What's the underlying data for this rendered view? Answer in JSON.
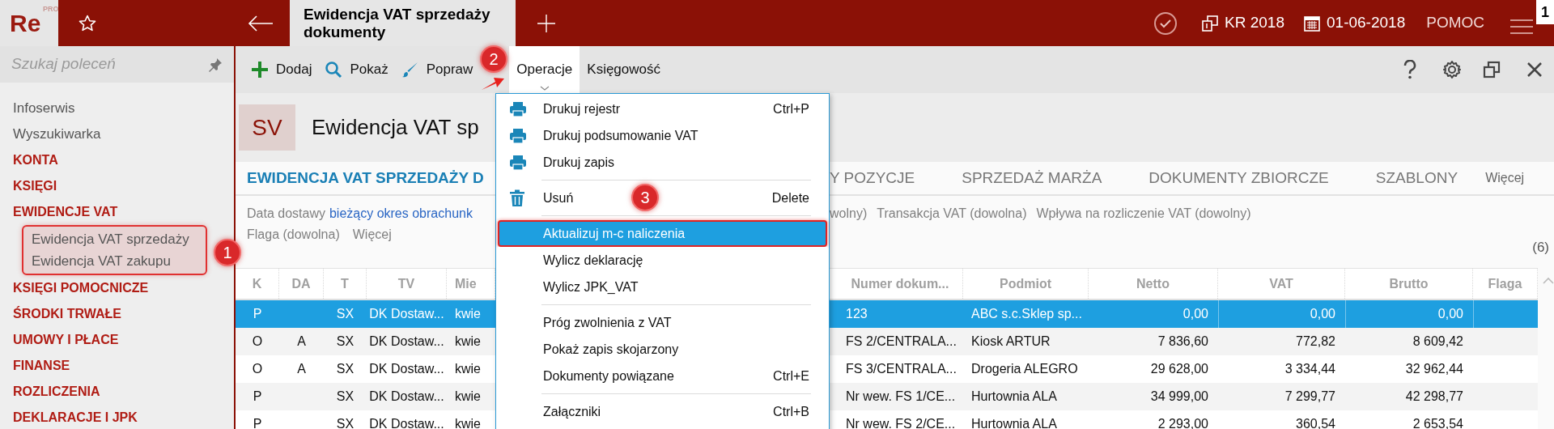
{
  "app": {
    "logo": "Re",
    "logo_badge": "PRO",
    "window_number": "1"
  },
  "top_bar": {
    "tab_title": "Ewidencja VAT sprzedaży dokumenty",
    "company": "KR 2018",
    "date": "01-06-2018",
    "help": "POMOC"
  },
  "sidebar": {
    "search_placeholder": "Szukaj poleceń",
    "items": [
      {
        "label": "Infoserwis",
        "kind": "link"
      },
      {
        "label": "Wyszukiwarka",
        "kind": "link"
      },
      {
        "label": "KONTA",
        "kind": "section"
      },
      {
        "label": "KSIĘGI",
        "kind": "section"
      },
      {
        "label": "EWIDENCJE VAT",
        "kind": "section",
        "children": [
          {
            "label": "Ewidencja VAT sprzedaży",
            "kind": "link"
          },
          {
            "label": "Ewidencja VAT zakupu",
            "kind": "link"
          }
        ]
      },
      {
        "label": "KSIĘGI POMOCNICZE",
        "kind": "section"
      },
      {
        "label": "ŚRODKI TRWAŁE",
        "kind": "section"
      },
      {
        "label": "UMOWY I PŁACE",
        "kind": "section"
      },
      {
        "label": "FINANSE",
        "kind": "section"
      },
      {
        "label": "ROZLICZENIA",
        "kind": "section"
      },
      {
        "label": "DEKLARACJE I JPK",
        "kind": "section"
      }
    ]
  },
  "toolbar": {
    "buttons": [
      {
        "label": "Dodaj",
        "kind": "action"
      },
      {
        "label": "Pokaż",
        "kind": "action"
      },
      {
        "label": "Popraw",
        "kind": "action"
      },
      {
        "label": "Operacje",
        "kind": "menu",
        "open": true
      },
      {
        "label": "Księgowość",
        "kind": "menu",
        "open": false
      }
    ]
  },
  "view": {
    "badge": "SV",
    "title": "Ewidencja VAT sp",
    "tabs": [
      {
        "label": "EWIDENCJA VAT SPRZEDAŻY D",
        "selected": true
      },
      {
        "label": "Y POZYCJE",
        "selected": false
      },
      {
        "label": "SPRZEDAŻ MARŻA",
        "selected": false
      },
      {
        "label": "DOKUMENTY ZBIORCZE",
        "selected": false
      },
      {
        "label": "SZABLONY",
        "selected": false
      }
    ],
    "tabs_more": "Więcej",
    "filters": [
      {
        "label": "Data dostawy",
        "value": "bieżący okres obrachunk"
      },
      {
        "label": "wolny)"
      },
      {
        "label": "Transakcja VAT (dowolna)"
      },
      {
        "label": "Wpływa na rozliczenie VAT (dowolny)"
      }
    ],
    "filters_line2": [
      "Flaga (dowolna)"
    ],
    "filters_more": "Więcej",
    "count": "(6)"
  },
  "table": {
    "columns": [
      "K",
      "DA",
      "T",
      "TV",
      "Mie",
      "Numer dokum...",
      "Podmiot",
      "Netto",
      "VAT",
      "Brutto",
      "Flaga"
    ],
    "rows": [
      {
        "cells": [
          "P",
          "",
          "SX",
          "DK Dostaw...",
          "kwie",
          "123",
          "ABC s.c.Sklep sp...",
          "0,00",
          "0,00",
          "0,00"
        ],
        "selected": true
      },
      {
        "cells": [
          "O",
          "A",
          "SX",
          "DK Dostaw...",
          "kwie",
          "FS 2/CENTRALA...",
          "Kiosk ARTUR",
          "7 836,60",
          "772,82",
          "8 609,42"
        ],
        "selected": false
      },
      {
        "cells": [
          "O",
          "A",
          "SX",
          "DK Dostaw...",
          "kwie",
          "FS 3/CENTRALA...",
          "Drogeria ALEGRO",
          "29 628,00",
          "3 334,44",
          "32 962,44"
        ],
        "selected": false
      },
      {
        "cells": [
          "P",
          "",
          "SX",
          "DK Dostaw...",
          "kwie",
          "Nr wew. FS 1/CE...",
          "Hurtownia ALA",
          "34 999,00",
          "7 299,77",
          "42 298,77"
        ],
        "selected": false
      },
      {
        "cells": [
          "P",
          "",
          "SX",
          "DK Dostaw...",
          "kwie",
          "Nr wew. FS 2/CE...",
          "Hurtownia ALA",
          "2 293,00",
          "360,54",
          "2 653,54"
        ],
        "selected": false
      }
    ]
  },
  "menu": {
    "groups": [
      [
        {
          "label": "Drukuj rejestr",
          "shortcut": "Ctrl+P",
          "selected": false
        },
        {
          "label": "Drukuj podsumowanie VAT",
          "selected": false
        },
        {
          "label": "Drukuj zapis",
          "selected": false
        }
      ],
      [
        {
          "label": "Usuń",
          "shortcut": "Delete",
          "selected": false
        }
      ],
      [
        {
          "label": "Aktualizuj m-c naliczenia",
          "selected": true
        },
        {
          "label": "Wylicz deklarację",
          "selected": false
        },
        {
          "label": "Wylicz JPK_VAT",
          "selected": false
        }
      ],
      [
        {
          "label": "Próg zwolnienia z VAT",
          "selected": false
        },
        {
          "label": "Pokaż zapis skojarzony",
          "selected": false
        },
        {
          "label": "Dokumenty powiązane",
          "shortcut": "Ctrl+E",
          "selected": false
        }
      ],
      [
        {
          "label": "Załączniki",
          "shortcut": "Ctrl+B",
          "selected": false
        }
      ]
    ]
  },
  "callouts": [
    {
      "label": "1"
    },
    {
      "label": "2"
    },
    {
      "label": "3"
    }
  ]
}
